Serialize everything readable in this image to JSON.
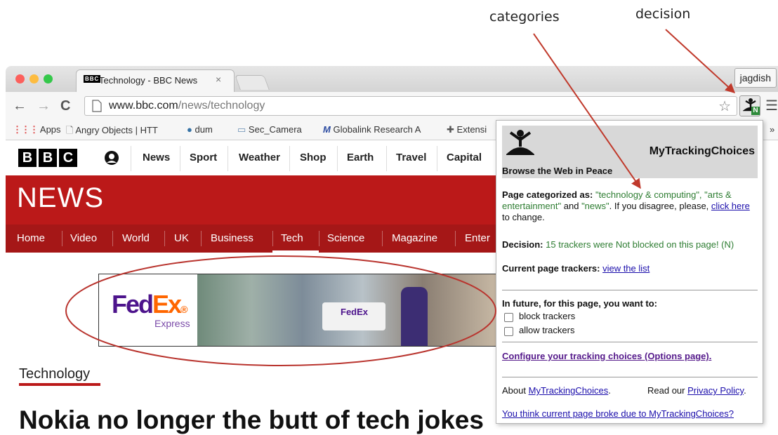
{
  "annotations": {
    "categories": "categories",
    "decision": "decision"
  },
  "browser": {
    "tab_title": "Technology - BBC News",
    "tab_favicon": "BBC",
    "user_name": "jagdish",
    "url_host": "www.bbc.com",
    "url_path": "/news/technology",
    "bookmarks": [
      "Apps",
      "Angry Objects | HTT",
      "dum",
      "Sec_Camera",
      "Globalink Research A",
      "Extensi"
    ]
  },
  "bbc": {
    "logo_letters": [
      "B",
      "B",
      "C"
    ],
    "top_nav": [
      "News",
      "Sport",
      "Weather",
      "Shop",
      "Earth",
      "Travel",
      "Capital"
    ],
    "section_title": "NEWS",
    "news_nav": [
      "Home",
      "Video",
      "World",
      "UK",
      "Business",
      "Tech",
      "Science",
      "Magazine",
      "Enter"
    ],
    "ad": {
      "brand_fed": "Fed",
      "brand_ex": "Ex",
      "brand_sub": "Express",
      "truck_logo": "FedEx"
    },
    "page_label": "Technology",
    "headline": "Nokia no longer the butt of tech jokes"
  },
  "popup": {
    "ext_badge": "N",
    "title": "MyTrackingChoices",
    "tagline": "Browse the Web in Peace",
    "cat_prefix": "Page categorized as:",
    "categories": "\"technology & computing\", \"arts & entertainment\"",
    "cat_and": "and",
    "cat_news": "\"news\"",
    "cat_disagree": ". If you disagree, please,",
    "cat_link": "click here",
    "cat_suffix": "to change.",
    "decision_label": "Decision:",
    "decision_text": "15 trackers were Not blocked on this page! (N)",
    "trackers_label": "Current page trackers:",
    "trackers_link": "view the list",
    "future_label": "In future, for this page, you want to:",
    "option_block": "block trackers",
    "option_allow": "allow trackers",
    "configure_link": "Configure your tracking choices (Options page).",
    "about_prefix": "About",
    "about_link": "MyTrackingChoices",
    "about_dot": ".",
    "privacy_prefix": "Read our",
    "privacy_link": "Privacy Policy",
    "privacy_dot": ".",
    "broke_link": "You think current page broke due to MyTrackingChoices?"
  },
  "colors": {
    "bbc_red": "#bb1919",
    "fedex_purple": "#4d148c",
    "fedex_orange": "#ff6600",
    "annotation_red": "#c0392b"
  },
  "icons": [
    "star-icon",
    "menu-icon",
    "reload-icon",
    "meditation-icon",
    "folder-icon",
    "python-icon"
  ]
}
